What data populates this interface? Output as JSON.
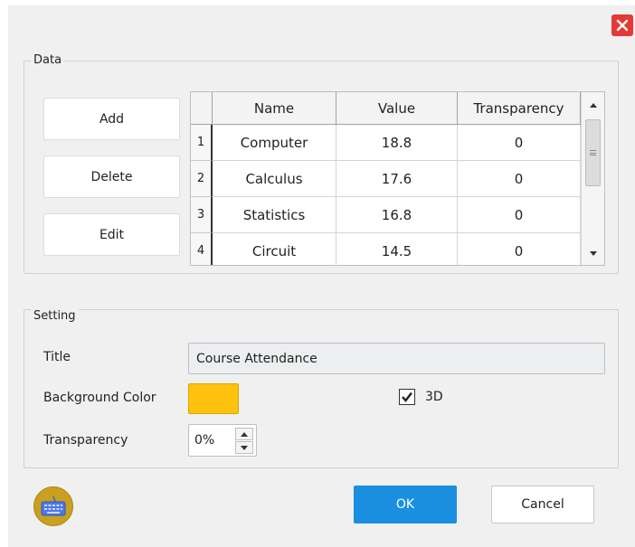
{
  "dialog": {
    "close_icon": "close-icon",
    "accent_color": "#1a8fe0",
    "close_color": "#e53935"
  },
  "data_group": {
    "legend": "Data",
    "buttons": {
      "add": "Add",
      "delete": "Delete",
      "edit": "Edit"
    },
    "table": {
      "columns": [
        "Name",
        "Value",
        "Transparency"
      ],
      "rows": [
        {
          "index": "1",
          "name": "Computer",
          "value": "18.8",
          "transparency": "0"
        },
        {
          "index": "2",
          "name": "Calculus",
          "value": "17.6",
          "transparency": "0"
        },
        {
          "index": "3",
          "name": "Statistics",
          "value": "16.8",
          "transparency": "0"
        },
        {
          "index": "4",
          "name": "Circuit",
          "value": "14.5",
          "transparency": "0"
        }
      ]
    }
  },
  "setting_group": {
    "legend": "Setting",
    "title_label": "Title",
    "title_value": "Course Attendance",
    "background_color_label": "Background Color",
    "background_color": "#ffc20e",
    "three_d_label": "3D",
    "three_d_checked": true,
    "transparency_label": "Transparency",
    "transparency_value": "0%"
  },
  "footer": {
    "keyboard_icon": "keyboard-icon",
    "ok_label": "OK",
    "cancel_label": "Cancel"
  }
}
